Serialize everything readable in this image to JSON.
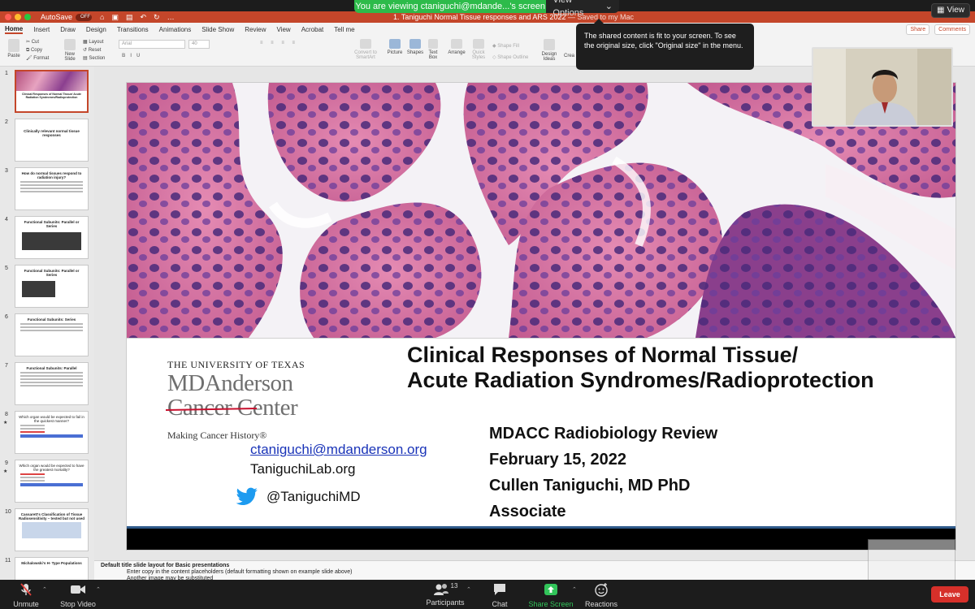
{
  "share_banner": {
    "viewing_text": "You are viewing ctaniguchi@mdande...'s screen",
    "view_options": "View Options",
    "view_button": "View"
  },
  "ppt": {
    "autosave_label": "AutoSave",
    "autosave_state": "OFF",
    "doc_title": "1. Taniguchi Normal Tissue responses and ARS 2022",
    "saved_status": "— Saved to my Mac"
  },
  "ribbon": {
    "tabs": [
      "Home",
      "Insert",
      "Draw",
      "Design",
      "Transitions",
      "Animations",
      "Slide Show",
      "Review",
      "View",
      "Acrobat",
      "Tell me"
    ],
    "share": "Share",
    "comments": "Comments",
    "paste": "Paste",
    "cut": "Cut",
    "copy": "Copy",
    "format": "Format",
    "new_slide": "New Slide",
    "layout": "Layout",
    "reset": "Reset",
    "section": "Section",
    "font_name": "Arial",
    "font_size": "40",
    "convert_smartart": "Convert to SmartArt",
    "picture": "Picture",
    "shapes": "Shapes",
    "text_box": "Text Box",
    "arrange": "Arrange",
    "quick_styles": "Quick Styles",
    "shape_fill": "Shape Fill",
    "shape_outline": "Shape Outline",
    "design_ideas": "Design Ideas",
    "create": "Crea"
  },
  "tooltip": "The shared content is fit to your screen. To see the original size, click \"Original size\" in the menu.",
  "thumbnails": [
    {
      "num": "1",
      "title": "Clinical Responses of Normal Tissue/ Acute Radiation Syndromes/Radioprotection",
      "star": ""
    },
    {
      "num": "2",
      "title": "Clinically relevant normal tissue responses",
      "star": ""
    },
    {
      "num": "3",
      "title": "How do normal tissues respond to radiation injury?",
      "star": ""
    },
    {
      "num": "4",
      "title": "Functional Subunits: Parallel or Series",
      "star": ""
    },
    {
      "num": "5",
      "title": "Functional Subunits: Parallel or Series",
      "star": ""
    },
    {
      "num": "6",
      "title": "Functional Subunits: Series",
      "star": ""
    },
    {
      "num": "7",
      "title": "Functional Subunits: Parallel",
      "star": ""
    },
    {
      "num": "8",
      "title": "Which organ would be expected to fail in the quickest manner?",
      "star": "★"
    },
    {
      "num": "9",
      "title": "Which organ would be expected to have the greatest mortality?",
      "star": "★"
    },
    {
      "num": "10",
      "title": "Cassarett's Classification of Tissue Radiosensitivity – tested but not used",
      "star": ""
    },
    {
      "num": "11",
      "title": "Michalowski's H- Type Populations",
      "star": ""
    }
  ],
  "slide": {
    "logo": {
      "university": "THE UNIVERSITY OF TEXAS",
      "md_anderson": "MDAnderson",
      "cancer_center": "Cancer Center",
      "tagline": "Making Cancer History®"
    },
    "title_line1": "Clinical Responses of Normal Tissue/",
    "title_line2": "Acute Radiation Syndromes/Radioprotection",
    "details": [
      "MDACC Radiobiology Review",
      "February 15, 2022",
      "Cullen Taniguchi, MD PhD",
      "Associate"
    ],
    "email": "ctaniguchi@mdanderson.org",
    "website": "TaniguchiLab.org",
    "twitter": "@TaniguchiMD"
  },
  "notes": {
    "line1": "Default title slide layout for Basic presentations",
    "line2": "Enter copy in the content placeholders (default formatting shown on example slide above)",
    "line3": "Another image may be substituted"
  },
  "zoom_toolbar": {
    "unmute": "Unmute",
    "stop_video": "Stop Video",
    "participants": "Participants",
    "participant_count": "13",
    "chat": "Chat",
    "share_screen": "Share Screen",
    "reactions": "Reactions",
    "leave": "Leave"
  },
  "colors": {
    "ppt_accent": "#c4462a",
    "zoom_green": "#2dbb4a",
    "leave_red": "#d6302a",
    "link_blue": "#1a34b8",
    "strike_red": "#c8102e"
  }
}
